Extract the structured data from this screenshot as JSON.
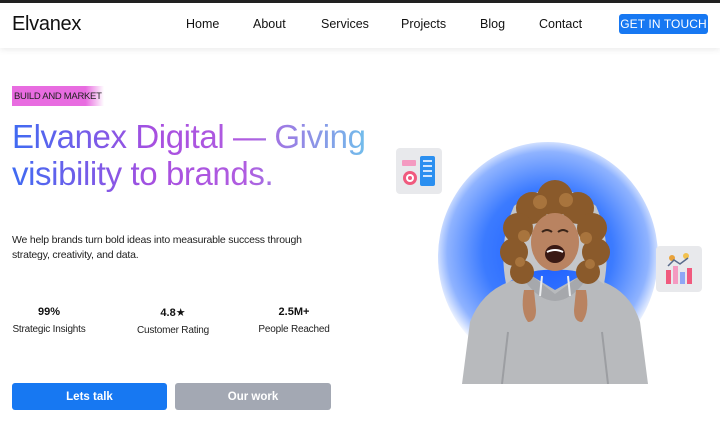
{
  "header": {
    "logo": "Elvanex",
    "nav": [
      "Home",
      "About",
      "Services",
      "Projects",
      "Blog",
      "Contact"
    ],
    "cta": "GET IN TOUCH"
  },
  "hero": {
    "eyebrow": "BUILD AND MARKET",
    "headline": "Elvanex Digital — Giving visibility to brands.",
    "subcopy": "We help brands turn bold ideas into measurable success through strategy, creativity, and data.",
    "stats": [
      {
        "value": "99%",
        "label": "Strategic Insights"
      },
      {
        "value": "4.8★",
        "label": "Customer Rating"
      },
      {
        "value": "2.5M+",
        "label": "People Reached"
      }
    ],
    "primary_button": "Lets talk",
    "secondary_button": "Our work"
  },
  "icons": {
    "card_a": "dashboard-target-icon",
    "card_b": "bar-chart-people-icon"
  },
  "colors": {
    "accent": "#1778f2",
    "secondary_button": "#a3a8b3",
    "eyebrow_highlight": "#e86ce0",
    "glow": "#1a5cff"
  }
}
